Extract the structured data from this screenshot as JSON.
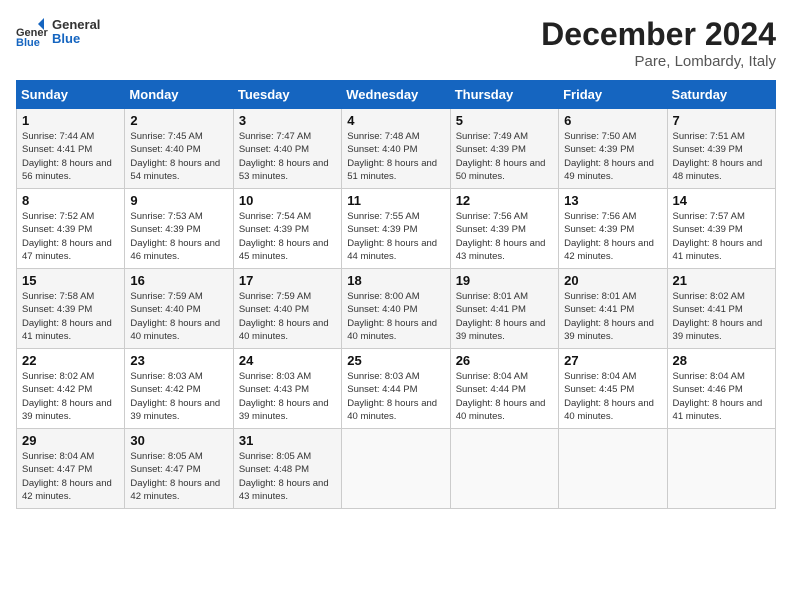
{
  "header": {
    "logo_general": "General",
    "logo_blue": "Blue",
    "month_title": "December 2024",
    "location": "Pare, Lombardy, Italy"
  },
  "weekdays": [
    "Sunday",
    "Monday",
    "Tuesday",
    "Wednesday",
    "Thursday",
    "Friday",
    "Saturday"
  ],
  "weeks": [
    [
      {
        "day": "1",
        "sunrise": "7:44 AM",
        "sunset": "4:41 PM",
        "daylight": "8 hours and 56 minutes."
      },
      {
        "day": "2",
        "sunrise": "7:45 AM",
        "sunset": "4:40 PM",
        "daylight": "8 hours and 54 minutes."
      },
      {
        "day": "3",
        "sunrise": "7:47 AM",
        "sunset": "4:40 PM",
        "daylight": "8 hours and 53 minutes."
      },
      {
        "day": "4",
        "sunrise": "7:48 AM",
        "sunset": "4:40 PM",
        "daylight": "8 hours and 51 minutes."
      },
      {
        "day": "5",
        "sunrise": "7:49 AM",
        "sunset": "4:39 PM",
        "daylight": "8 hours and 50 minutes."
      },
      {
        "day": "6",
        "sunrise": "7:50 AM",
        "sunset": "4:39 PM",
        "daylight": "8 hours and 49 minutes."
      },
      {
        "day": "7",
        "sunrise": "7:51 AM",
        "sunset": "4:39 PM",
        "daylight": "8 hours and 48 minutes."
      }
    ],
    [
      {
        "day": "8",
        "sunrise": "7:52 AM",
        "sunset": "4:39 PM",
        "daylight": "8 hours and 47 minutes."
      },
      {
        "day": "9",
        "sunrise": "7:53 AM",
        "sunset": "4:39 PM",
        "daylight": "8 hours and 46 minutes."
      },
      {
        "day": "10",
        "sunrise": "7:54 AM",
        "sunset": "4:39 PM",
        "daylight": "8 hours and 45 minutes."
      },
      {
        "day": "11",
        "sunrise": "7:55 AM",
        "sunset": "4:39 PM",
        "daylight": "8 hours and 44 minutes."
      },
      {
        "day": "12",
        "sunrise": "7:56 AM",
        "sunset": "4:39 PM",
        "daylight": "8 hours and 43 minutes."
      },
      {
        "day": "13",
        "sunrise": "7:56 AM",
        "sunset": "4:39 PM",
        "daylight": "8 hours and 42 minutes."
      },
      {
        "day": "14",
        "sunrise": "7:57 AM",
        "sunset": "4:39 PM",
        "daylight": "8 hours and 41 minutes."
      }
    ],
    [
      {
        "day": "15",
        "sunrise": "7:58 AM",
        "sunset": "4:39 PM",
        "daylight": "8 hours and 41 minutes."
      },
      {
        "day": "16",
        "sunrise": "7:59 AM",
        "sunset": "4:40 PM",
        "daylight": "8 hours and 40 minutes."
      },
      {
        "day": "17",
        "sunrise": "7:59 AM",
        "sunset": "4:40 PM",
        "daylight": "8 hours and 40 minutes."
      },
      {
        "day": "18",
        "sunrise": "8:00 AM",
        "sunset": "4:40 PM",
        "daylight": "8 hours and 40 minutes."
      },
      {
        "day": "19",
        "sunrise": "8:01 AM",
        "sunset": "4:41 PM",
        "daylight": "8 hours and 39 minutes."
      },
      {
        "day": "20",
        "sunrise": "8:01 AM",
        "sunset": "4:41 PM",
        "daylight": "8 hours and 39 minutes."
      },
      {
        "day": "21",
        "sunrise": "8:02 AM",
        "sunset": "4:41 PM",
        "daylight": "8 hours and 39 minutes."
      }
    ],
    [
      {
        "day": "22",
        "sunrise": "8:02 AM",
        "sunset": "4:42 PM",
        "daylight": "8 hours and 39 minutes."
      },
      {
        "day": "23",
        "sunrise": "8:03 AM",
        "sunset": "4:42 PM",
        "daylight": "8 hours and 39 minutes."
      },
      {
        "day": "24",
        "sunrise": "8:03 AM",
        "sunset": "4:43 PM",
        "daylight": "8 hours and 39 minutes."
      },
      {
        "day": "25",
        "sunrise": "8:03 AM",
        "sunset": "4:44 PM",
        "daylight": "8 hours and 40 minutes."
      },
      {
        "day": "26",
        "sunrise": "8:04 AM",
        "sunset": "4:44 PM",
        "daylight": "8 hours and 40 minutes."
      },
      {
        "day": "27",
        "sunrise": "8:04 AM",
        "sunset": "4:45 PM",
        "daylight": "8 hours and 40 minutes."
      },
      {
        "day": "28",
        "sunrise": "8:04 AM",
        "sunset": "4:46 PM",
        "daylight": "8 hours and 41 minutes."
      }
    ],
    [
      {
        "day": "29",
        "sunrise": "8:04 AM",
        "sunset": "4:47 PM",
        "daylight": "8 hours and 42 minutes."
      },
      {
        "day": "30",
        "sunrise": "8:05 AM",
        "sunset": "4:47 PM",
        "daylight": "8 hours and 42 minutes."
      },
      {
        "day": "31",
        "sunrise": "8:05 AM",
        "sunset": "4:48 PM",
        "daylight": "8 hours and 43 minutes."
      },
      null,
      null,
      null,
      null
    ]
  ],
  "labels": {
    "sunrise": "Sunrise:",
    "sunset": "Sunset:",
    "daylight": "Daylight:"
  }
}
